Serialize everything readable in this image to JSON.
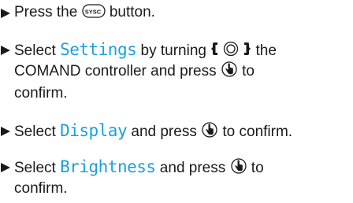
{
  "steps": [
    {
      "lines": [
        {
          "t1": "Press the ",
          "icon": "sysc-button-icon",
          "t2": " button."
        }
      ]
    },
    {
      "lines": [
        {
          "t1": "Select ",
          "term": "Settings",
          "t2": " by turning ",
          "icon": "turn-controller-icon",
          "t3": " the"
        },
        {
          "t1": "COMAND controller and press ",
          "icon": "press-controller-icon",
          "t2": " to"
        },
        {
          "t1": "confirm."
        }
      ]
    },
    {
      "lines": [
        {
          "t1": "Select ",
          "term": "Display",
          "t2": " and press ",
          "icon": "press-controller-icon",
          "t3": " to confirm."
        }
      ]
    },
    {
      "lines": [
        {
          "t1": "Select ",
          "term": "Brightness",
          "t2": " and press ",
          "icon": "press-controller-icon",
          "t3": " to"
        },
        {
          "t1": "confirm."
        }
      ]
    }
  ],
  "icons": {
    "sysc_label": "SYSC"
  },
  "colors": {
    "ui_term": "#1aa0dc",
    "text": "#1a1a1a"
  }
}
